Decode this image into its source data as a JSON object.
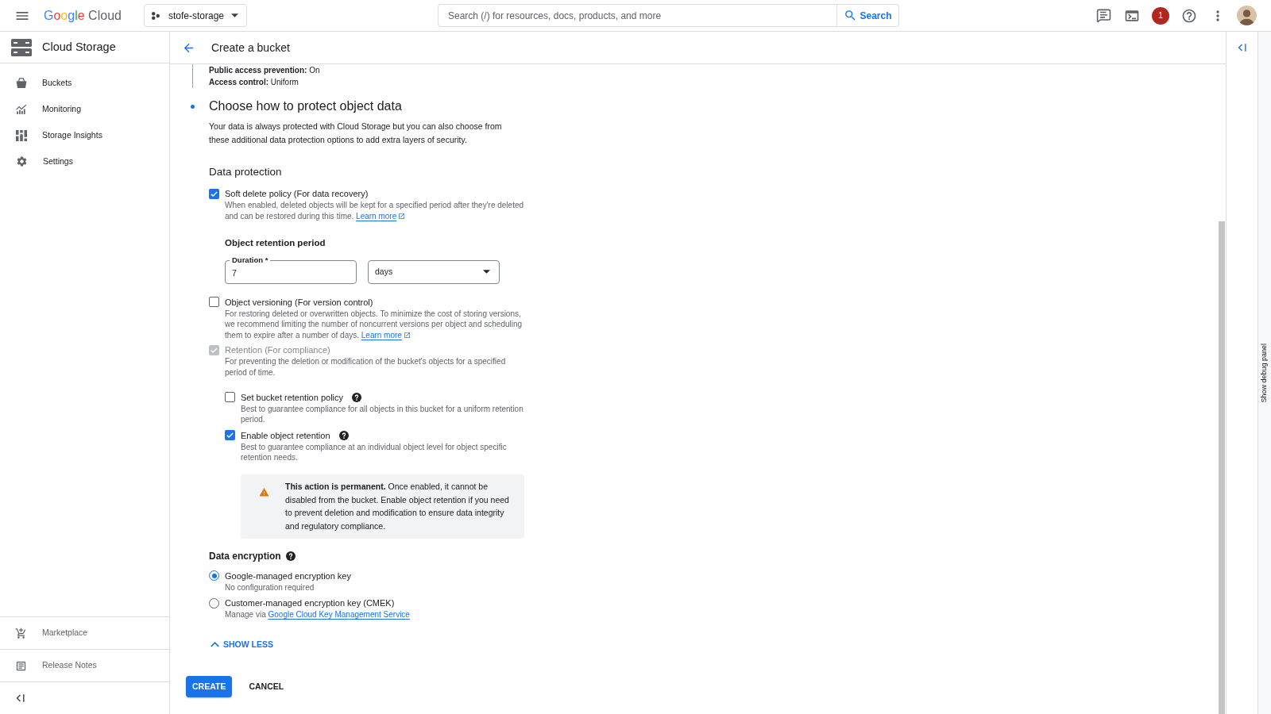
{
  "top_bar": {
    "logo": "Google Cloud",
    "project": "stofe-storage",
    "search_placeholder": "Search (/) for resources, docs, products, and more",
    "search_button": "Search",
    "notification_count": "1"
  },
  "sidebar": {
    "title": "Cloud Storage",
    "items": [
      {
        "label": "Buckets"
      },
      {
        "label": "Monitoring"
      },
      {
        "label": "Storage Insights"
      },
      {
        "label": "Settings"
      }
    ],
    "footer_items": [
      {
        "label": "Marketplace"
      },
      {
        "label": "Release Notes"
      }
    ]
  },
  "page": {
    "title": "Create a bucket"
  },
  "summary": [
    "**Public access prevention:** On",
    "**Access control:** Uniform"
  ],
  "section": {
    "title": "Choose how to protect object data",
    "description": "Your data is always protected with Cloud Storage but you can also choose from these additional data protection options to add extra layers of security."
  },
  "data_protection": {
    "title": "Data protection",
    "options": [
      {
        "label": "Soft delete policy (For data recovery)",
        "checked": true,
        "disabled": false,
        "help": false,
        "description": "When enabled, deleted objects will be kept for a specified period after they're deleted and can be restored during this time.",
        "link": "Learn more",
        "retention_period": {
          "title": "Object retention period",
          "duration": {
            "label": "Duration *",
            "value": "7"
          },
          "unit": "days"
        }
      },
      {
        "label": "Object versioning (For version control)",
        "checked": false,
        "disabled": false,
        "help": false,
        "description": "For restoring deleted or overwritten objects. To minimize the cost of storing versions, we recommend limiting the number of noncurrent versions per object and scheduling them to expire after a number of days.",
        "link": "Learn more"
      },
      {
        "label": "Retention (For compliance)",
        "checked": true,
        "disabled": true,
        "help": false,
        "description": "For preventing the deletion or modification of the bucket's objects for a specified period of time.",
        "children": [
          {
            "label": "Set bucket retention policy",
            "checked": false,
            "disabled": false,
            "help": true,
            "description": "Best to guarantee compliance for all objects in this bucket for a uniform retention period."
          },
          {
            "label": "Enable object retention",
            "checked": true,
            "disabled": false,
            "help": true,
            "description": "Best to guarantee compliance at an individual object level for object specific retention needs."
          }
        ],
        "warning": "**This action is permanent.** Once enabled, it cannot be disabled from the bucket. Enable object retention if you need to prevent deletion and modification to ensure data integrity and regulatory compliance."
      }
    ]
  },
  "data_encryption": {
    "title": "Data encryption",
    "help": true,
    "options": [
      {
        "label": "Google-managed encryption key",
        "description": "No configuration required",
        "selected": true
      },
      {
        "label": "Customer-managed encryption key (CMEK)",
        "description": "Manage via",
        "link": "Google Cloud Key Management Service",
        "selected": false
      }
    ]
  },
  "show_less": {
    "label": "SHOW LESS",
    "expanded": true
  },
  "buttons": [
    {
      "label": "CREATE",
      "kind": "primary"
    },
    {
      "label": "CANCEL",
      "kind": "text"
    }
  ],
  "debug_panel": {
    "label": "Show debug panel"
  }
}
